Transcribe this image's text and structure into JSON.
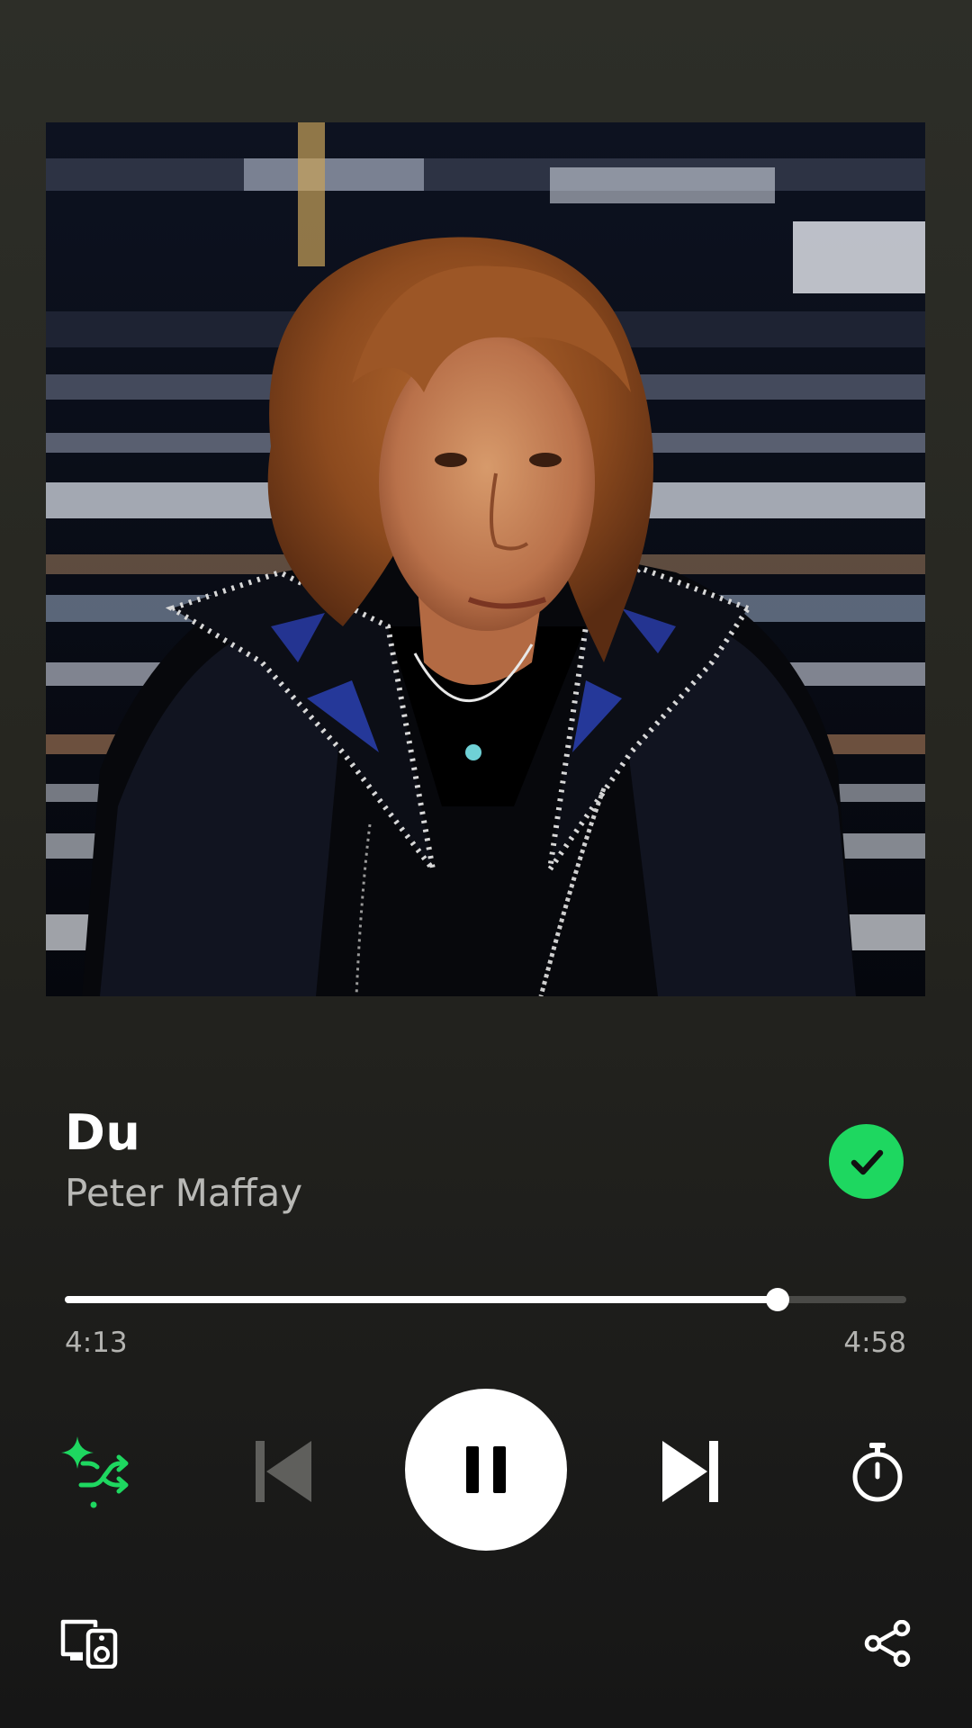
{
  "now_playing": {
    "title": "Du",
    "artist": "Peter Maffay",
    "liked": true,
    "album_art": "Portrait of Peter Maffay in a studded black leather jacket"
  },
  "playback": {
    "elapsed": "4:13",
    "total": "4:58",
    "progress_fraction": 0.847,
    "state": "playing"
  },
  "controls": {
    "smart_shuffle_icon": "smart-shuffle-icon",
    "previous_icon": "skip-previous-icon",
    "play_pause_icon": "pause-icon",
    "next_icon": "skip-next-icon",
    "timer_icon": "sleep-timer-icon",
    "device_icon": "connect-device-icon",
    "share_icon": "share-icon"
  },
  "colors": {
    "accent_green": "#1ed760",
    "background_top": "#2d2e28",
    "background_bottom": "#161616",
    "text_secondary": "#b9b9b6"
  }
}
